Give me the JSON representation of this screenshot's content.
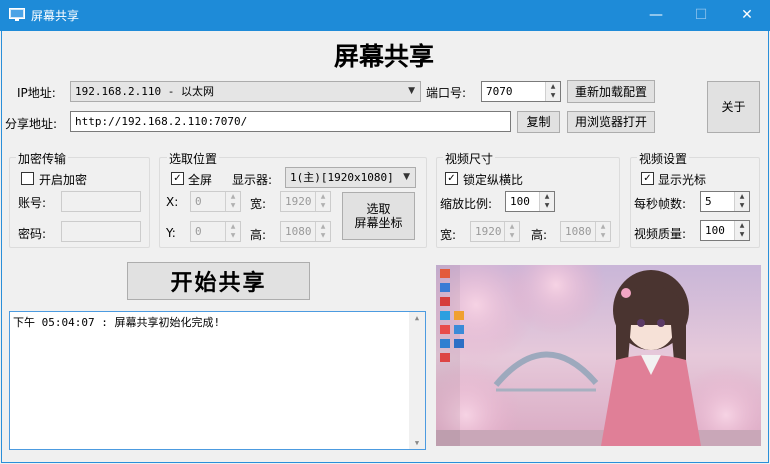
{
  "window": {
    "title": "屏幕共享",
    "minimize": "—",
    "maximize": "☐",
    "close": "✕"
  },
  "heading": "屏幕共享",
  "ip": {
    "label": "IP地址:",
    "value": "192.168.2.110 - 以太网"
  },
  "port": {
    "label": "端口号:",
    "value": "7070"
  },
  "reload_button": "重新加载配置",
  "about_button": "关于",
  "share": {
    "label": "分享地址:",
    "value": "http://192.168.2.110:7070/",
    "copy": "复制",
    "open_browser": "用浏览器打开"
  },
  "encrypt": {
    "title": "加密传输",
    "enable_label": "开启加密",
    "enable_checked": false,
    "account_label": "账号:",
    "password_label": "密码:"
  },
  "region": {
    "title": "选取位置",
    "fullscreen_label": "全屏",
    "fullscreen_checked": true,
    "display_label": "显示器:",
    "display_value": "1(主)[1920x1080]",
    "x_label": "X:",
    "x": "0",
    "width_label": "宽:",
    "width": "1920",
    "y_label": "Y:",
    "y": "0",
    "height_label": "高:",
    "height": "1080",
    "pick_button": "选取\n屏幕坐标"
  },
  "video_size": {
    "title": "视频尺寸",
    "lock_label": "锁定纵横比",
    "lock_checked": true,
    "scale_label": "缩放比例:",
    "scale": "100",
    "width_label": "宽:",
    "width": "1920",
    "height_label": "高:",
    "height": "1080"
  },
  "video_settings": {
    "title": "视频设置",
    "cursor_label": "显示光标",
    "cursor_checked": true,
    "fps_label": "每秒帧数:",
    "fps": "5",
    "quality_label": "视频质量:",
    "quality": "100"
  },
  "start_button": "开始共享",
  "log": {
    "lines": [
      "下午 05:04:07 : 屏幕共享初始化完成!"
    ]
  },
  "preview": {
    "description": "screen preview of desktop wallpaper"
  },
  "colors": {
    "titlebar": "#1e8bd8",
    "log_border": "#4c9be0"
  }
}
